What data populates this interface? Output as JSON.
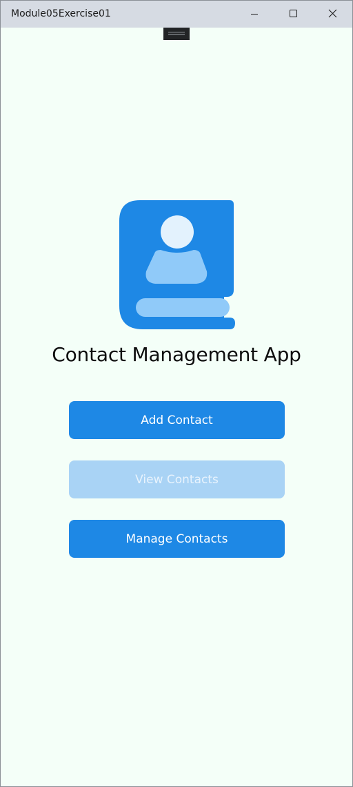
{
  "window": {
    "title": "Module05Exercise01",
    "controls": {
      "minimize": "minimize-icon",
      "maximize": "maximize-icon",
      "close": "close-icon"
    }
  },
  "colors": {
    "background": "#f4fff8",
    "primary": "#1e88e5",
    "primary_disabled": "#a9d3f5",
    "logo_light": "#90caf9",
    "logo_lighter": "#e3f2fd"
  },
  "logo": {
    "icon": "contact-book-icon"
  },
  "main": {
    "title": "Contact Management App",
    "buttons": [
      {
        "label": "Add Contact",
        "enabled": true
      },
      {
        "label": "View Contacts",
        "enabled": false
      },
      {
        "label": "Manage Contacts",
        "enabled": true
      }
    ]
  }
}
